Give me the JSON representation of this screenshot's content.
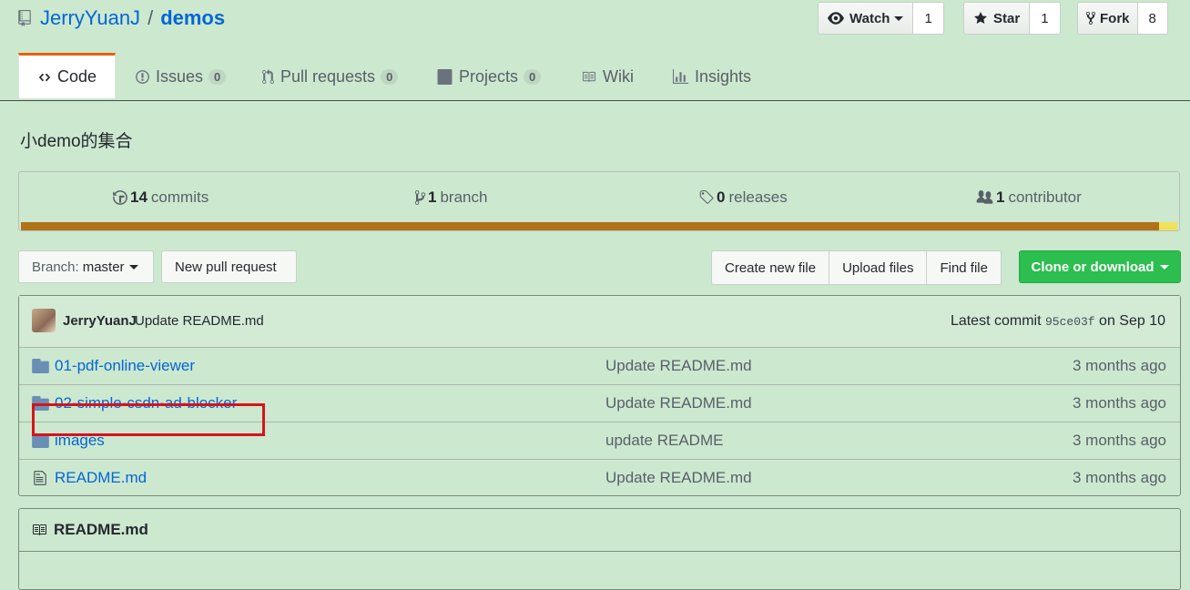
{
  "repo": {
    "owner": "JerryYuanJ",
    "separator": "/",
    "name": "demos"
  },
  "actions": {
    "watch": {
      "label": "Watch",
      "count": "1"
    },
    "star": {
      "label": "Star",
      "count": "1"
    },
    "fork": {
      "label": "Fork",
      "count": "8"
    }
  },
  "tabs": [
    {
      "label": "Code",
      "icon": "code-icon"
    },
    {
      "label": "Issues",
      "count": "0",
      "icon": "issue-icon"
    },
    {
      "label": "Pull requests",
      "count": "0",
      "icon": "pull-request-icon"
    },
    {
      "label": "Projects",
      "count": "0",
      "icon": "project-icon"
    },
    {
      "label": "Wiki",
      "icon": "book-icon"
    },
    {
      "label": "Insights",
      "icon": "graph-icon"
    }
  ],
  "description": "小demo的集合",
  "summary": {
    "commits": {
      "count": "14",
      "label": "commits"
    },
    "branches": {
      "count": "1",
      "label": "branch"
    },
    "releases": {
      "count": "0",
      "label": "releases"
    },
    "contributors": {
      "count": "1",
      "label": "contributor"
    }
  },
  "language_colors": {
    "primary": "#b07219",
    "secondary": "#f1e05a"
  },
  "file_nav": {
    "branch_prefix": "Branch:",
    "branch": "master",
    "new_pr": "New pull request",
    "create_file": "Create new file",
    "upload": "Upload files",
    "find": "Find file",
    "clone": "Clone or download"
  },
  "latest_commit": {
    "author": "JerryYuanJ",
    "message": "Update README.md",
    "prefix": "Latest commit",
    "sha": "95ce03f",
    "date": "on Sep 10"
  },
  "files": [
    {
      "type": "dir",
      "name": "01-pdf-online-viewer",
      "message": "Update README.md",
      "age": "3 months ago"
    },
    {
      "type": "dir",
      "name": "02-simple-csdn-ad-blocker",
      "message": "Update README.md",
      "age": "3 months ago"
    },
    {
      "type": "dir",
      "name": "images",
      "message": "update README",
      "age": "3 months ago"
    },
    {
      "type": "file",
      "name": "README.md",
      "message": "Update README.md",
      "age": "3 months ago"
    }
  ],
  "readme": {
    "title": "README.md"
  }
}
